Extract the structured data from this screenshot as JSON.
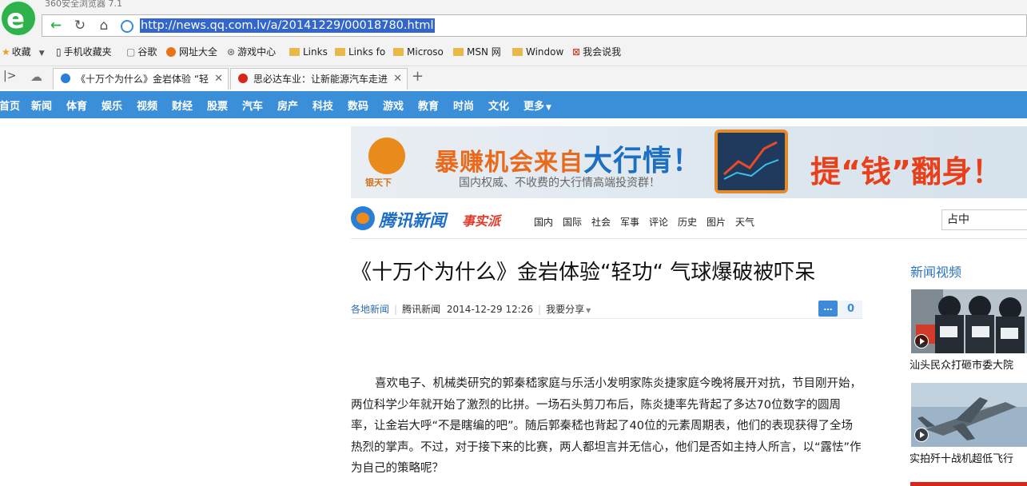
{
  "browser": {
    "window_title": "360安全浏览器 7.1",
    "url": "http://news.qq.com.lv/a/20141229/00018780.html",
    "favorites": [
      {
        "label": "收藏",
        "icon": "star-icon"
      },
      {
        "label": "手机收藏夹",
        "icon": "phone-icon"
      },
      {
        "label": "谷歌",
        "icon": "page-icon"
      },
      {
        "label": "网址大全",
        "icon": "globe-icon"
      },
      {
        "label": "游戏中心",
        "icon": "gamepad-icon"
      },
      {
        "label": "Links",
        "icon": "folder-icon"
      },
      {
        "label": "Links fo",
        "icon": "folder-icon"
      },
      {
        "label": "Microso",
        "icon": "folder-icon"
      },
      {
        "label": "MSN 网",
        "icon": "folder-icon"
      },
      {
        "label": "Window",
        "icon": "folder-icon"
      },
      {
        "label": "我会说我",
        "icon": "close-box-icon"
      }
    ],
    "tabs": [
      {
        "label": "《十万个为什么》金岩体验 “轻",
        "active": true
      },
      {
        "label": "思必达车业：让新能源汽车走进",
        "active": false
      }
    ],
    "new_tab": "+"
  },
  "site_nav": [
    "首页",
    "新闻",
    "体育",
    "娱乐",
    "视频",
    "财经",
    "股票",
    "汽车",
    "房产",
    "科技",
    "数码",
    "游戏",
    "教育",
    "时尚",
    "文化",
    "更多"
  ],
  "banner": {
    "logo_label": "银天下",
    "headline_a": "暴赚机会来自",
    "headline_b": "大行情！",
    "subline": "国内权威、不收费的大行情高端投资群！",
    "tail": "提“钱”翻身！"
  },
  "brand": {
    "name": "腾讯新闻",
    "tag": "事实派",
    "categories": [
      "国内",
      "国际",
      "社会",
      "军事",
      "评论",
      "历史",
      "图片",
      "天气"
    ],
    "search_value": "占中"
  },
  "article": {
    "title": "《十万个为什么》金岩体验“轻功“ 气球爆破被吓呆",
    "source": "各地新闻",
    "publisher": "腾讯新闻",
    "datetime": "2014-12-29 12:26",
    "share": "我要分享",
    "comment_count": "0",
    "body": "喜欢电子、机械类研究的郭秦嵇家庭与乐活小发明家陈炎捷家庭今晚将展开对抗，节目刚开始，两位科学少年就开始了激烈的比拼。一场石头剪刀布后，陈炎捷率先背起了多达70位数字的圆周率，让金岩大呼“不是瞎编的吧”。随后郭秦嵇也背起了40位的元素周期表，他们的表现获得了全场热烈的掌声。不过，对于接下来的比赛，两人都坦言并无信心，他们是否如主持人所言，以“露怯”作为自己的策略呢？"
  },
  "sidebar": {
    "title": "新闻视频",
    "videos": [
      {
        "caption": "汕头民众打砸市委大院"
      },
      {
        "caption": "实拍歼十战机超低飞行"
      }
    ]
  },
  "colors": {
    "nav_blue": "#3b8fd9",
    "accent_green": "#2fb24b",
    "link_blue": "#2b6cb3",
    "brand_red": "#d9261c"
  }
}
